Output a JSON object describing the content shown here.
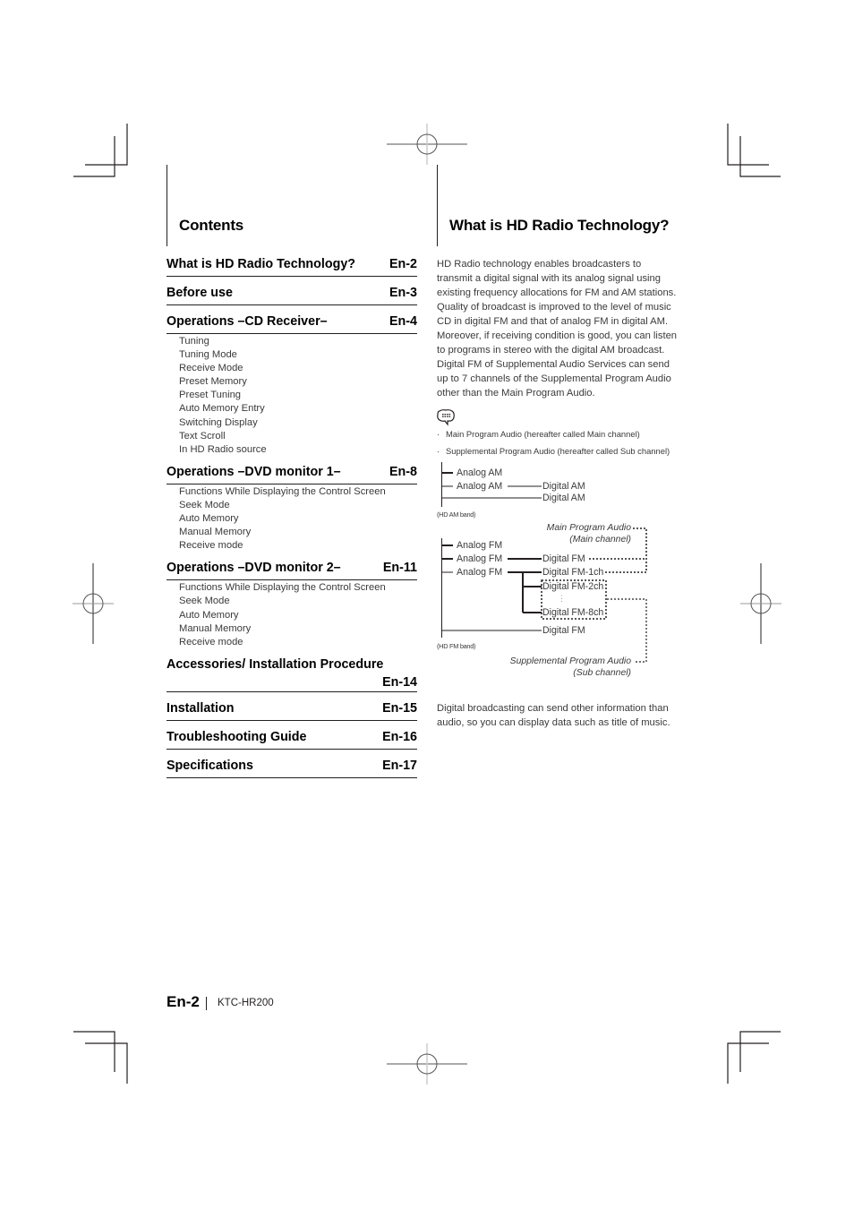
{
  "left_section": {
    "title": "Contents",
    "toc": [
      {
        "label": "What is HD Radio Technology?",
        "page": "En-2",
        "subitems": []
      },
      {
        "label": "Before use",
        "page": "En-3",
        "subitems": []
      },
      {
        "label": "Operations –CD Receiver–",
        "page": "En-4",
        "subitems": [
          "Tuning",
          "Tuning Mode",
          "Receive Mode",
          "Preset Memory",
          "Preset Tuning",
          "Auto Memory Entry",
          "Switching Display",
          "Text Scroll",
          "In HD Radio source"
        ]
      },
      {
        "label": "Operations –DVD monitor 1–",
        "page": "En-8",
        "subitems": [
          "Functions While Displaying the Control Screen",
          "Seek Mode",
          "Auto Memory",
          "Manual Memory",
          "Receive mode"
        ]
      },
      {
        "label": "Operations –DVD monitor 2–",
        "page": "En-11",
        "subitems": [
          "Functions While Displaying the Control Screen",
          "Seek Mode",
          "Auto Memory",
          "Manual Memory",
          "Receive mode"
        ]
      },
      {
        "label": "Accessories/ Installation Procedure",
        "page": "En-14",
        "subitems": []
      },
      {
        "label": "Installation",
        "page": "En-15",
        "subitems": []
      },
      {
        "label": "Troubleshooting Guide",
        "page": "En-16",
        "subitems": []
      },
      {
        "label": "Specifications",
        "page": "En-17",
        "subitems": []
      }
    ]
  },
  "right_section": {
    "title": "What is HD Radio Technology?",
    "intro_lines": [
      "HD Radio technology enables broadcasters to",
      "transmit a digital signal with its analog signal using",
      "existing frequency allocations for FM and AM stations.",
      "Quality of broadcast is improved to the level of music",
      "CD in digital FM and that of analog FM in digital AM.",
      "Moreover, if receiving condition is good, you can listen",
      "to programs in stereo with the digital AM broadcast.",
      "Digital FM of Supplemental Audio Services can send",
      "up to 7 channels of the Supplemental Program Audio",
      "other than the Main Program Audio."
    ],
    "note_icon": "note-speech-bubble-icon",
    "notes": [
      "Main Program Audio (hereafter called Main channel)",
      "Supplemental Program Audio (hereafter called Sub channel)"
    ],
    "diagram": {
      "am_band": {
        "caption": "(HD AM band)",
        "analog": [
          "Analog AM",
          "Analog AM"
        ],
        "digital": [
          "Digital AM",
          "Digital AM"
        ]
      },
      "fm_band": {
        "caption": "(HD FM band)",
        "analog": [
          "Analog FM",
          "Analog FM",
          "Analog FM"
        ],
        "digital": [
          "Digital FM",
          "Digital FM-1ch",
          "Digital FM-2ch",
          "⋮",
          "Digital FM-8ch",
          "Digital FM"
        ],
        "main_label": [
          "Main Program Audio",
          "(Main channel)"
        ],
        "sub_label": [
          "Supplemental Program Audio",
          "(Sub channel)"
        ]
      }
    },
    "closing_lines": [
      "Digital broadcasting can send other information than",
      "audio, so you can display data such as title of music."
    ]
  },
  "footer": {
    "page_number": "En-2",
    "model": "KTC-HR200"
  }
}
